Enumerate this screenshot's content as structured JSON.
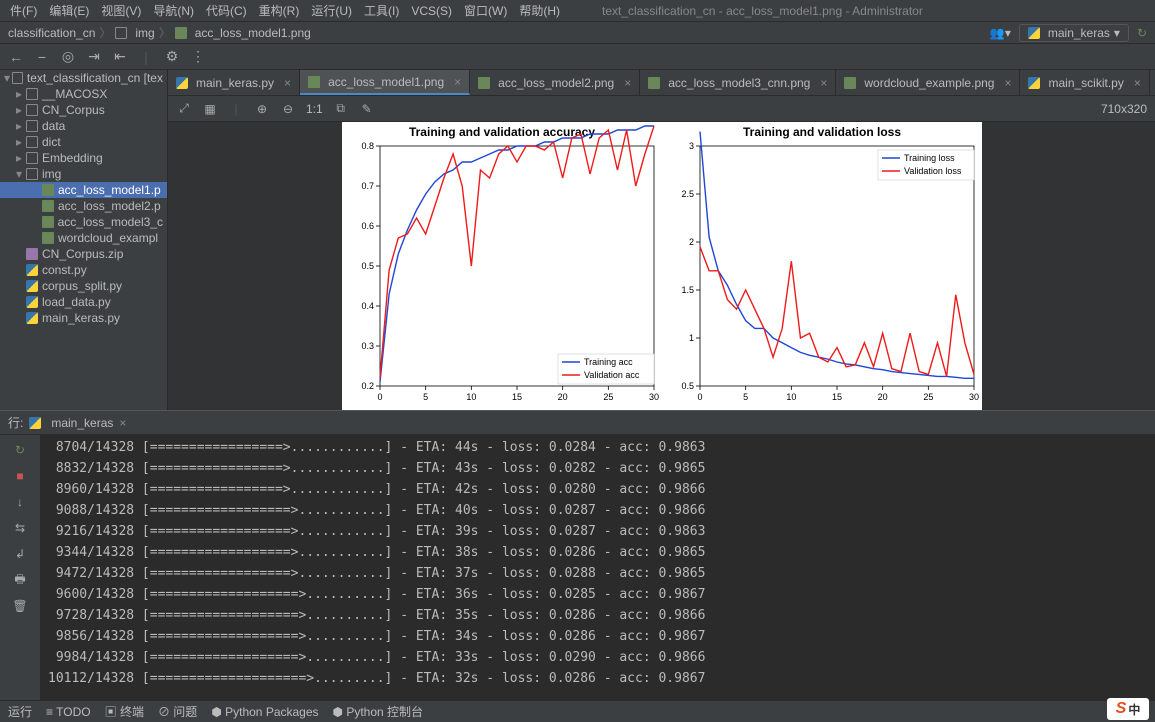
{
  "window": {
    "title": "text_classification_cn - acc_loss_model1.png - Administrator"
  },
  "menu": [
    "件(F)",
    "编辑(E)",
    "视图(V)",
    "导航(N)",
    "代码(C)",
    "重构(R)",
    "运行(U)",
    "工具(I)",
    "VCS(S)",
    "窗口(W)",
    "帮助(H)"
  ],
  "breadcrumb": {
    "a": "classification_cn",
    "b": "img",
    "c": "acc_loss_model1.png"
  },
  "runconfig": "main_keras",
  "tabs": [
    {
      "label": "main_keras.py",
      "type": "py",
      "active": false
    },
    {
      "label": "acc_loss_model1.png",
      "type": "img",
      "active": true
    },
    {
      "label": "acc_loss_model2.png",
      "type": "img",
      "active": false
    },
    {
      "label": "acc_loss_model3_cnn.png",
      "type": "img",
      "active": false
    },
    {
      "label": "wordcloud_example.png",
      "type": "img",
      "active": false
    },
    {
      "label": "main_scikit.py",
      "type": "py",
      "active": false
    }
  ],
  "tree": {
    "root": "text_classification_cn [tex",
    "items": [
      {
        "label": "__MACOSX",
        "kind": "dir",
        "depth": 1
      },
      {
        "label": "CN_Corpus",
        "kind": "dir",
        "depth": 1
      },
      {
        "label": "data",
        "kind": "dir",
        "depth": 1
      },
      {
        "label": "dict",
        "kind": "dir",
        "depth": 1
      },
      {
        "label": "Embedding",
        "kind": "dir",
        "depth": 1
      },
      {
        "label": "img",
        "kind": "dir",
        "depth": 1,
        "open": true
      },
      {
        "label": "acc_loss_model1.p",
        "kind": "img",
        "depth": 2,
        "sel": true
      },
      {
        "label": "acc_loss_model2.p",
        "kind": "img",
        "depth": 2
      },
      {
        "label": "acc_loss_model3_c",
        "kind": "img",
        "depth": 2
      },
      {
        "label": "wordcloud_exampl",
        "kind": "img",
        "depth": 2
      },
      {
        "label": "CN_Corpus.zip",
        "kind": "file",
        "depth": 1
      },
      {
        "label": "const.py",
        "kind": "py",
        "depth": 1
      },
      {
        "label": "corpus_split.py",
        "kind": "py",
        "depth": 1
      },
      {
        "label": "load_data.py",
        "kind": "py",
        "depth": 1
      },
      {
        "label": "main_keras.py",
        "kind": "py",
        "depth": 1
      }
    ]
  },
  "image_toolbar": {
    "zoom": "1:1",
    "dims": "710x320"
  },
  "run_left": "行:",
  "run_tab": "main_keras",
  "console_lines": [
    " 8704/14328 [=================>............] - ETA: 44s - loss: 0.0284 - acc: 0.9863",
    " 8832/14328 [=================>............] - ETA: 43s - loss: 0.0282 - acc: 0.9865",
    " 8960/14328 [=================>............] - ETA: 42s - loss: 0.0280 - acc: 0.9866",
    " 9088/14328 [==================>...........] - ETA: 40s - loss: 0.0287 - acc: 0.9866",
    " 9216/14328 [==================>...........] - ETA: 39s - loss: 0.0287 - acc: 0.9863",
    " 9344/14328 [==================>...........] - ETA: 38s - loss: 0.0286 - acc: 0.9865",
    " 9472/14328 [==================>...........] - ETA: 37s - loss: 0.0288 - acc: 0.9865",
    " 9600/14328 [===================>..........] - ETA: 36s - loss: 0.0285 - acc: 0.9867",
    " 9728/14328 [===================>..........] - ETA: 35s - loss: 0.0286 - acc: 0.9866",
    " 9856/14328 [===================>..........] - ETA: 34s - loss: 0.0286 - acc: 0.9867",
    " 9984/14328 [===================>..........] - ETA: 33s - loss: 0.0290 - acc: 0.9866",
    "10112/14328 [====================>.........] - ETA: 32s - loss: 0.0286 - acc: 0.9867"
  ],
  "statusbar": {
    "run": "运行",
    "todo": "TODO",
    "term": "终端",
    "prob": "问题",
    "pkg": "Python Packages",
    "pycon": "Python 控制台"
  },
  "chart_data": [
    {
      "type": "line",
      "title": "Training and validation accuracy",
      "x": [
        0,
        1,
        2,
        3,
        4,
        5,
        6,
        7,
        8,
        9,
        10,
        11,
        12,
        13,
        14,
        15,
        16,
        17,
        18,
        19,
        20,
        21,
        22,
        23,
        24,
        25,
        26,
        27,
        28,
        29,
        30
      ],
      "series": [
        {
          "name": "Training acc",
          "color": "#1f47d7",
          "values": [
            0.21,
            0.43,
            0.53,
            0.59,
            0.64,
            0.68,
            0.71,
            0.73,
            0.74,
            0.76,
            0.76,
            0.77,
            0.78,
            0.79,
            0.79,
            0.8,
            0.8,
            0.8,
            0.81,
            0.81,
            0.82,
            0.82,
            0.82,
            0.83,
            0.83,
            0.83,
            0.84,
            0.84,
            0.84,
            0.85,
            0.85
          ]
        },
        {
          "name": "Validation acc",
          "color": "#ef1a1a",
          "values": [
            0.22,
            0.49,
            0.57,
            0.58,
            0.62,
            0.58,
            0.65,
            0.72,
            0.78,
            0.7,
            0.5,
            0.74,
            0.72,
            0.78,
            0.8,
            0.76,
            0.8,
            0.8,
            0.79,
            0.81,
            0.72,
            0.82,
            0.83,
            0.73,
            0.82,
            0.84,
            0.74,
            0.84,
            0.7,
            0.78,
            0.85
          ]
        }
      ],
      "xticks": [
        0,
        5,
        10,
        15,
        20,
        25,
        30
      ],
      "yticks": [
        0.2,
        0.3,
        0.4,
        0.5,
        0.6,
        0.7,
        0.8
      ]
    },
    {
      "type": "line",
      "title": "Training and validation loss",
      "x": [
        0,
        1,
        2,
        3,
        4,
        5,
        6,
        7,
        8,
        9,
        10,
        11,
        12,
        13,
        14,
        15,
        16,
        17,
        18,
        19,
        20,
        21,
        22,
        23,
        24,
        25,
        26,
        27,
        28,
        29,
        30
      ],
      "series": [
        {
          "name": "Training loss",
          "color": "#1f47d7",
          "values": [
            3.15,
            2.05,
            1.7,
            1.55,
            1.35,
            1.18,
            1.1,
            1.1,
            1.0,
            0.95,
            0.9,
            0.85,
            0.82,
            0.8,
            0.78,
            0.75,
            0.73,
            0.72,
            0.7,
            0.68,
            0.67,
            0.65,
            0.64,
            0.63,
            0.62,
            0.61,
            0.6,
            0.6,
            0.59,
            0.58,
            0.58
          ]
        },
        {
          "name": "Validation loss",
          "color": "#ef1a1a",
          "values": [
            1.95,
            1.7,
            1.7,
            1.4,
            1.3,
            1.5,
            1.3,
            1.1,
            0.8,
            1.1,
            1.8,
            1.0,
            1.05,
            0.8,
            0.75,
            0.9,
            0.7,
            0.72,
            0.95,
            0.7,
            1.05,
            0.68,
            0.65,
            1.05,
            0.65,
            0.62,
            0.95,
            0.6,
            1.45,
            0.95,
            0.62
          ]
        }
      ],
      "xticks": [
        0,
        5,
        10,
        15,
        20,
        25,
        30
      ],
      "yticks": [
        0.5,
        1.0,
        1.5,
        2.0,
        2.5,
        3.0
      ]
    }
  ]
}
